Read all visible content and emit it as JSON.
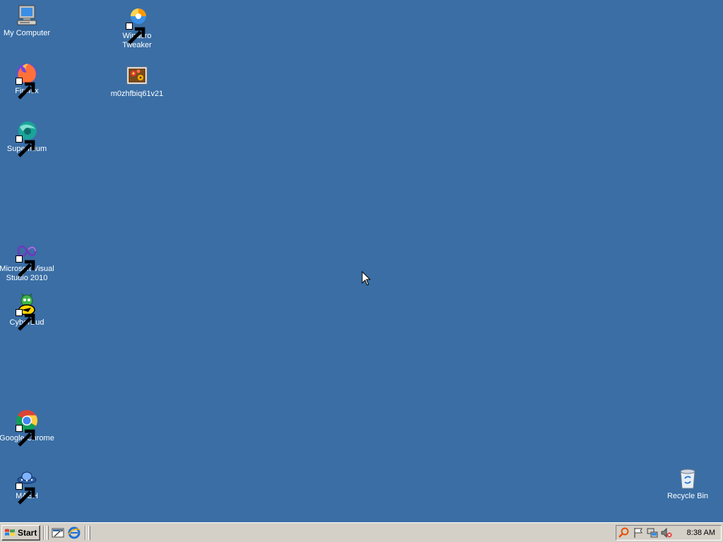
{
  "desktop": {
    "background": "#3a6ea5",
    "icons": [
      {
        "id": "my-computer",
        "label": "My Computer",
        "icon": "computer-icon",
        "shortcut": false
      },
      {
        "id": "firefox",
        "label": "Firefox",
        "icon": "firefox-icon",
        "shortcut": true
      },
      {
        "id": "supermium",
        "label": "Supermium",
        "icon": "supermium-icon",
        "shortcut": true
      },
      {
        "id": "visual-studio",
        "label": "Microsoft Visual Studio 2010",
        "icon": "visual-studio-icon",
        "shortcut": true
      },
      {
        "id": "cyberbud",
        "label": "CyberBud",
        "icon": "cyberbud-icon",
        "shortcut": true
      },
      {
        "id": "google-chrome",
        "label": "Google Chrome",
        "icon": "chrome-icon",
        "shortcut": true
      },
      {
        "id": "mash",
        "label": "MASH",
        "icon": "mash-icon",
        "shortcut": true
      },
      {
        "id": "winaero",
        "label": "Winaero Tweaker",
        "icon": "winaero-icon",
        "shortcut": true
      },
      {
        "id": "m0zhf",
        "label": "m0zhfbiq61v21",
        "icon": "image-file-icon",
        "shortcut": false
      },
      {
        "id": "recycle-bin",
        "label": "Recycle Bin",
        "icon": "recycle-bin-icon",
        "shortcut": false
      }
    ]
  },
  "taskbar": {
    "start_label": "Start",
    "quick_launch": [
      {
        "id": "show-desktop",
        "icon": "show-desktop-icon"
      },
      {
        "id": "internet-explorer",
        "icon": "internet-explorer-icon"
      }
    ],
    "tray_icons": [
      {
        "id": "search",
        "icon": "search-icon"
      },
      {
        "id": "action-center",
        "icon": "flag-icon"
      },
      {
        "id": "network",
        "icon": "network-icon"
      },
      {
        "id": "volume",
        "icon": "volume-muted-icon"
      }
    ],
    "clock": "8:38 AM"
  }
}
